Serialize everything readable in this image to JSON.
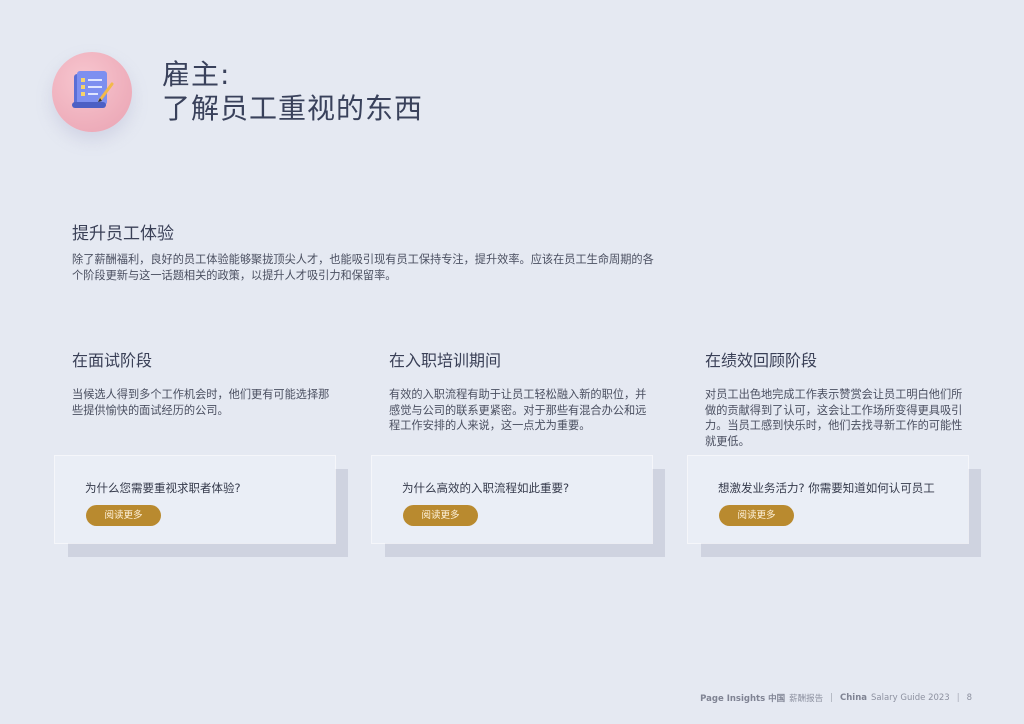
{
  "header": {
    "title_line1": "雇主:",
    "title_line2": "了解员工重视的东西",
    "icon": "checklist-scroll-icon"
  },
  "intro": {
    "heading": "提升员工体验",
    "body": "除了薪酬福利，良好的员工体验能够聚拢顶尖人才，也能吸引现有员工保持专注，提升效率。应该在员工生命周期的各个阶段更新与这一话题相关的政策，以提升人才吸引力和保留率。"
  },
  "columns": [
    {
      "heading": "在面试阶段",
      "body": "当候选人得到多个工作机会时，他们更有可能选择那些提供愉快的面试经历的公司。",
      "card_question": "为什么您需要重视求职者体验?",
      "card_button": "阅读更多"
    },
    {
      "heading": "在入职培训期间",
      "body": "有效的入职流程有助于让员工轻松融入新的职位，并感觉与公司的联系更紧密。对于那些有混合办公和远程工作安排的人来说，这一点尤为重要。",
      "card_question": "为什么高效的入职流程如此重要?",
      "card_button": "阅读更多"
    },
    {
      "heading": "在绩效回顾阶段",
      "body": "对员工出色地完成工作表示赞赏会让员工明白他们所做的贡献得到了认可，这会让工作场所变得更具吸引力。当员工感到快乐时，他们去找寻新工作的可能性就更低。",
      "card_question": "想激发业务活力? 你需要知道如何认可员工",
      "card_button": "阅读更多"
    }
  ],
  "footer": {
    "brand": "Page Insights 中国",
    "report": "薪酬报告",
    "guide_strong": "China",
    "guide": "Salary Guide 2023",
    "page": "8"
  },
  "colors": {
    "background": "#e5e9f2",
    "button": "#b98a2f",
    "icon_circle": "#efb0bd"
  }
}
